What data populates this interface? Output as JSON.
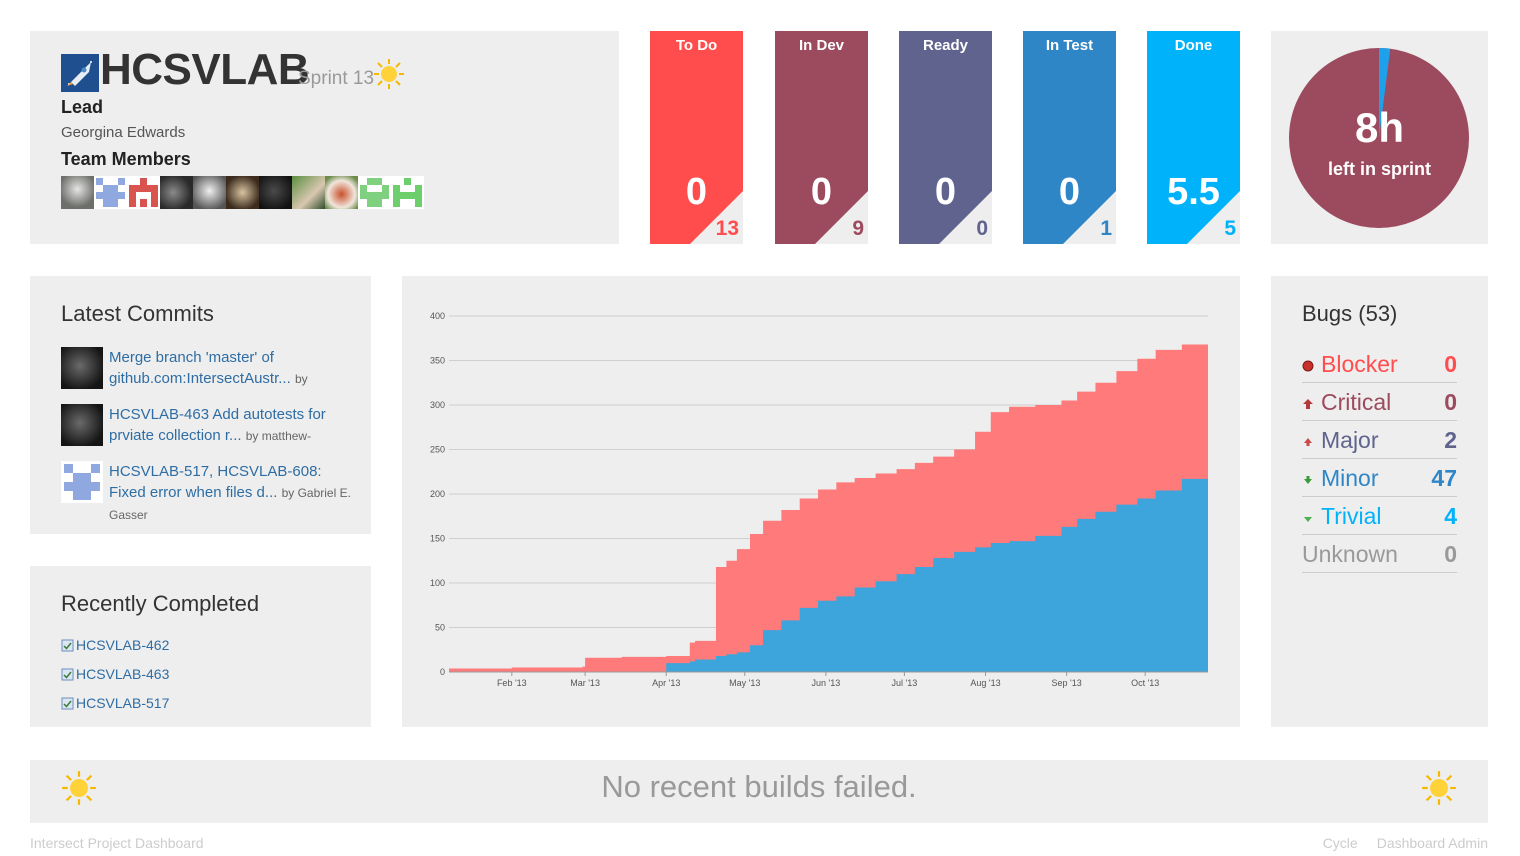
{
  "project": {
    "name": "HCSVLAB",
    "sprint": "Sprint 13",
    "lead_label": "Lead",
    "lead_name": "Georgina Edwards",
    "team_label": "Team Members",
    "team_avatars": [
      "avatar-1",
      "avatar-2",
      "avatar-3",
      "avatar-4",
      "avatar-5",
      "avatar-6",
      "avatar-7",
      "avatar-8",
      "avatar-9",
      "avatar-10",
      "avatar-11"
    ]
  },
  "status_tiles": [
    {
      "label": "To Do",
      "points": "0",
      "count": "13",
      "color": "#ff4d4d",
      "count_color": "#ff4d4d"
    },
    {
      "label": "In Dev",
      "points": "0",
      "count": "9",
      "color": "#9c4a5e",
      "count_color": "#9c4a5e"
    },
    {
      "label": "Ready",
      "points": "0",
      "count": "0",
      "color": "#5f638e",
      "count_color": "#5f638e"
    },
    {
      "label": "In Test",
      "points": "0",
      "count": "1",
      "color": "#2f86c7",
      "count_color": "#2f86c7"
    },
    {
      "label": "Done",
      "points": "5.5",
      "count": "5",
      "color": "#00b2fa",
      "count_color": "#00b2fa"
    }
  ],
  "sprint_time": {
    "hours": "8h",
    "label": "left in sprint",
    "remaining_fraction": 0.98,
    "remaining_color": "#9c4a5e",
    "elapsed_color": "#1fa0ea"
  },
  "commits": {
    "title": "Latest Commits",
    "items": [
      {
        "text": "Merge branch 'master' of github.com:IntersectAustr...",
        "by": "by"
      },
      {
        "text": "HCSVLAB-463 Add autotests for prviate collection r...",
        "by": "by matthew-"
      },
      {
        "text": "HCSVLAB-517, HCSVLAB-608: Fixed error when files d...",
        "by": "by Gabriel E. Gasser"
      }
    ]
  },
  "completed": {
    "title": "Recently Completed",
    "items": [
      "HCSVLAB-462",
      "HCSVLAB-463",
      "HCSVLAB-517"
    ]
  },
  "chart_data": {
    "type": "area",
    "x": [
      "2013-01-08",
      "2013-01-20",
      "2013-02-01",
      "2013-02-15",
      "2013-02-28",
      "2013-03-01",
      "2013-03-15",
      "2013-03-28",
      "2013-04-01",
      "2013-04-10",
      "2013-04-12",
      "2013-04-20",
      "2013-04-24",
      "2013-04-28",
      "2013-05-03",
      "2013-05-08",
      "2013-05-15",
      "2013-05-22",
      "2013-05-29",
      "2013-06-05",
      "2013-06-12",
      "2013-06-20",
      "2013-06-28",
      "2013-07-05",
      "2013-07-12",
      "2013-07-20",
      "2013-07-28",
      "2013-08-03",
      "2013-08-10",
      "2013-08-20",
      "2013-08-30",
      "2013-09-05",
      "2013-09-12",
      "2013-09-20",
      "2013-09-28",
      "2013-10-05",
      "2013-10-15",
      "2013-10-25"
    ],
    "series": [
      {
        "name": "",
        "color": "#ff7a7a",
        "values": [
          4,
          4,
          5,
          5,
          6,
          16,
          17,
          17,
          18,
          33,
          35,
          118,
          125,
          138,
          155,
          170,
          182,
          195,
          205,
          213,
          218,
          223,
          228,
          235,
          242,
          250,
          270,
          292,
          298,
          300,
          305,
          315,
          325,
          338,
          352,
          362,
          368,
          373
        ]
      },
      {
        "name": "",
        "color": "#3ea4dc",
        "values": [
          0,
          0,
          0,
          0,
          0,
          0,
          0,
          0,
          10,
          12,
          14,
          18,
          20,
          22,
          30,
          47,
          58,
          72,
          80,
          85,
          95,
          102,
          110,
          118,
          128,
          135,
          140,
          145,
          147,
          153,
          163,
          172,
          180,
          188,
          195,
          204,
          217,
          200
        ]
      }
    ],
    "x_ticks": [
      "Feb '13",
      "Mar '13",
      "Apr '13",
      "May '13",
      "Jun '13",
      "Jul '13",
      "Aug '13",
      "Sep '13",
      "Oct '13"
    ],
    "x_tick_dates": [
      "2013-02-01",
      "2013-03-01",
      "2013-04-01",
      "2013-05-01",
      "2013-06-01",
      "2013-07-01",
      "2013-08-01",
      "2013-09-01",
      "2013-10-01"
    ],
    "y_ticks": [
      "0",
      "50",
      "100",
      "150",
      "200",
      "250",
      "300",
      "350",
      "400"
    ],
    "ylim": [
      0,
      400
    ],
    "x_start": "2013-01-08",
    "x_end": "2013-10-25",
    "grid": true
  },
  "bugs": {
    "title": "Bugs (53)",
    "rows": [
      {
        "name": "Blocker",
        "count": "0",
        "color": "#ff4d4d",
        "icon": "blocker-icon"
      },
      {
        "name": "Critical",
        "count": "0",
        "color": "#9c4a5e",
        "icon": "critical-icon"
      },
      {
        "name": "Major",
        "count": "2",
        "color": "#5f638e",
        "icon": "major-icon"
      },
      {
        "name": "Minor",
        "count": "47",
        "color": "#2f86c7",
        "icon": "minor-icon"
      },
      {
        "name": "Trivial",
        "count": "4",
        "color": "#00b2fa",
        "icon": "trivial-icon"
      },
      {
        "name": "Unknown",
        "count": "0",
        "color": "#999999",
        "icon": ""
      }
    ]
  },
  "builds": {
    "message": "No recent builds failed."
  },
  "footer": {
    "left": "Intersect Project Dashboard",
    "cycle": "Cycle",
    "admin": "Dashboard Admin"
  }
}
